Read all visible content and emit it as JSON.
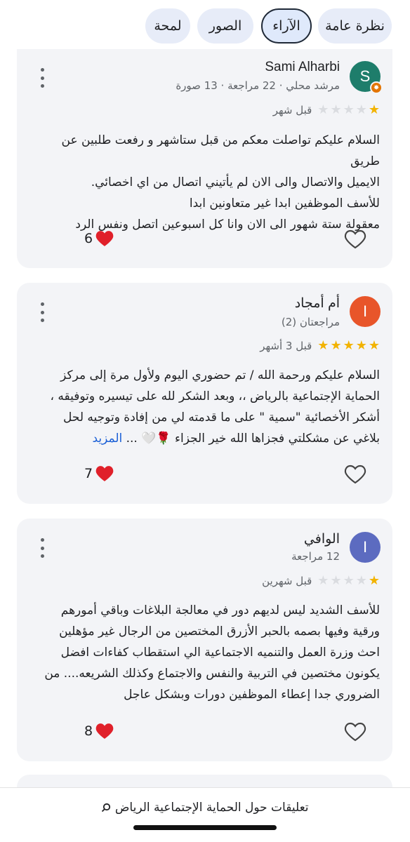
{
  "tabs": [
    {
      "label": "نظرة عامة",
      "active": false
    },
    {
      "label": "الآراء",
      "active": true
    },
    {
      "label": "الصور",
      "active": false
    },
    {
      "label": "لمحة",
      "active": false
    }
  ],
  "reviews": [
    {
      "avatar_letter": "S",
      "avatar_color": "#1e7d6b",
      "name": "Sami Alharbi",
      "meta": "مرشد محلي · 22 مراجعة · 13 صورة",
      "rating": 1,
      "time": "قبل شهر",
      "lines": [
        "السلام عليكم تواصلت معكم من قبل ستاشهر و رفعت طلبين عن طريق",
        "الايميل والاتصال والى الان لم يأتيني اتصال من اي اخصائي.",
        "للأسف الموظفين ابدا غير متعاونين ابدا",
        "معقولة ستة شهور الى الان وانا كل اسبوعين اتصل ونفس الرد"
      ],
      "reaction_count": "6"
    },
    {
      "avatar_letter": "I",
      "avatar_color": "#e8552a",
      "name": "أم أمجاد",
      "meta": "مراجعتان (2)",
      "rating": 5,
      "time": "قبل 3 أشهر",
      "lines": [
        "السلام عليكم ورحمة الله / تم حضوري اليوم ولأول مرة إلى مركز",
        "الحماية الإجتماعية بالرياض ،، وبعد الشكر لله على تيسيره وتوفيقه ،",
        "أشكر الأخصائية \"سمية \" على ما قدمته لي من إفادة وتوجيه لحل",
        "بلاغي عن مشكلتي فجزاها الله خير الجزاء 🌹🤍 ..."
      ],
      "more_label": "المزيد",
      "reaction_count": "7"
    },
    {
      "avatar_letter": "I",
      "avatar_color": "#5c6bc0",
      "name": "الوافي",
      "meta": "12 مراجعة",
      "rating": 1,
      "time": "قبل شهرين",
      "lines": [
        "للأسف الشديد ليس لديهم دور في معالجة البلاغات وباقي أمورهم",
        "ورقية وفيها بصمه بالحبر الأزرق المختصين من الرجال غير مؤهلين",
        "احث وزرة العمل والتنميه الاجتماعية الي استقطاب كفاءات افضل",
        "يكونون مختصين في التربية والنفس والاجتماع وكذلك الشريعه.... من",
        "الضروري جدا إعطاء الموظفين دورات وبشكل عاجل"
      ],
      "reaction_count": "8"
    }
  ],
  "bottom": {
    "label": "تعليقات حول الحماية الإجتماعية الرياض"
  },
  "icons": {
    "search": "search-icon",
    "heart": "red-heart-icon",
    "like": "heart-outline-icon",
    "more": "more-vertical-icon",
    "local_guide": "local-guide-badge-icon"
  },
  "colors": {
    "star": "#f2b300",
    "link": "#1a5fd6",
    "card_bg": "#f3f4f7"
  }
}
